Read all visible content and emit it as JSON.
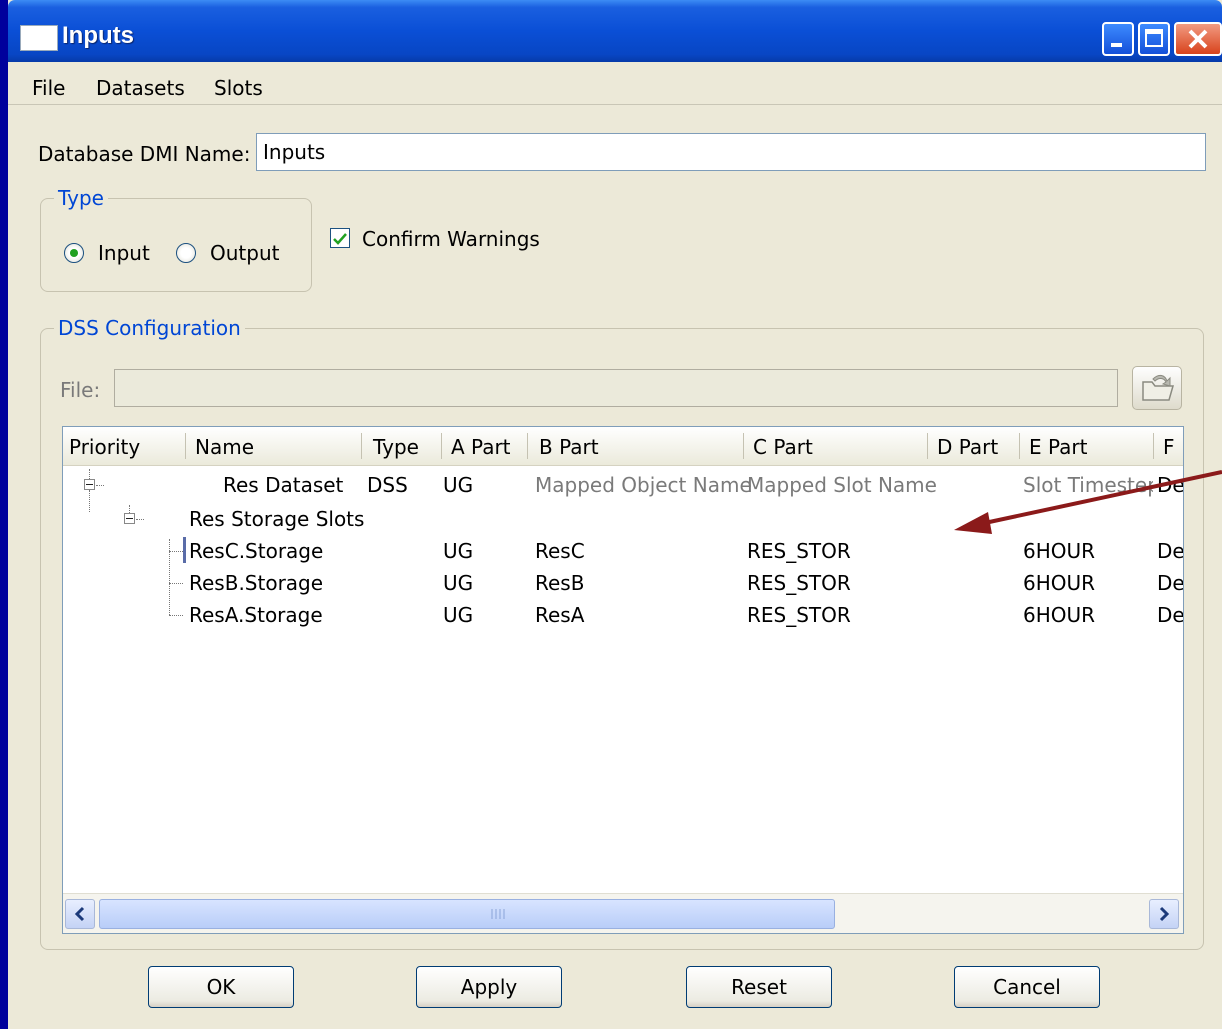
{
  "window": {
    "title": "Inputs"
  },
  "menu": [
    "File",
    "Datasets",
    "Slots"
  ],
  "db_name": {
    "label": "Database DMI Name:",
    "value": "Inputs"
  },
  "type_group": {
    "title": "Type",
    "input_label": "Input",
    "output_label": "Output",
    "selected": "Input"
  },
  "confirm_warnings": {
    "label": "Confirm Warnings",
    "checked": true
  },
  "dss_group": {
    "title": "DSS Configuration",
    "file_label": "File:",
    "file_value": ""
  },
  "table": {
    "columns": [
      "Priority",
      "Name",
      "Type",
      "A Part",
      "B Part",
      "C Part",
      "D Part",
      "E Part",
      "F"
    ],
    "dataset_row": {
      "name": "Res Dataset",
      "type": "DSS",
      "a_part": "UG",
      "b_part": "Mapped Object Name",
      "c_part": "Mapped Slot Name",
      "e_part": "Slot Timestep",
      "f_part": "De"
    },
    "group_row": {
      "name": "Res Storage Slots"
    },
    "slots": [
      {
        "name": "ResC.Storage",
        "a_part": "UG",
        "b_part": "ResC",
        "c_part": "RES_STOR",
        "e_part": "6HOUR",
        "f_part": "De"
      },
      {
        "name": "ResB.Storage",
        "a_part": "UG",
        "b_part": "ResB",
        "c_part": "RES_STOR",
        "e_part": "6HOUR",
        "f_part": "De"
      },
      {
        "name": "ResA.Storage",
        "a_part": "UG",
        "b_part": "ResA",
        "c_part": "RES_STOR",
        "e_part": "6HOUR",
        "f_part": "De"
      }
    ]
  },
  "buttons": {
    "ok": "OK",
    "apply": "Apply",
    "reset": "Reset",
    "cancel": "Cancel"
  },
  "colors": {
    "title_bar": "#0a4fd6",
    "background": "#00009c",
    "window": "#ece9d8",
    "arrow": "#8b1a1a",
    "group_title": "#0046d5"
  }
}
